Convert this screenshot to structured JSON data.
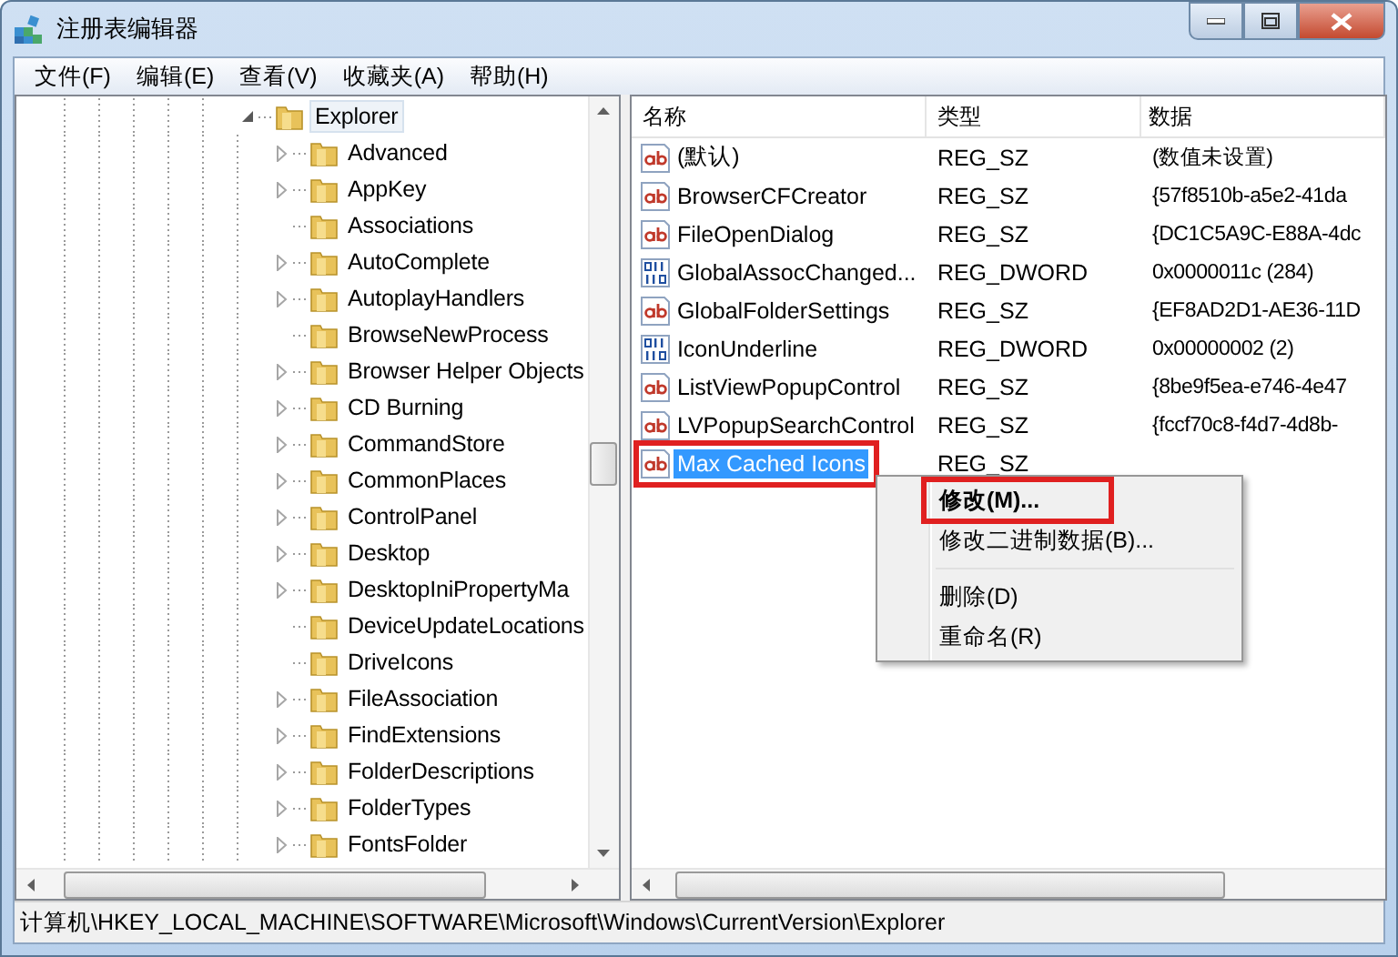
{
  "window": {
    "title": "注册表编辑器"
  },
  "menu": [
    "文件(F)",
    "编辑(E)",
    "查看(V)",
    "收藏夹(A)",
    "帮助(H)"
  ],
  "tree": {
    "label": "Explorer",
    "expanded": true,
    "selected": false,
    "children": [
      {
        "label": "Advanced",
        "kind": "branch"
      },
      {
        "label": "AppKey",
        "kind": "branch"
      },
      {
        "label": "Associations",
        "kind": "leaf"
      },
      {
        "label": "AutoComplete",
        "kind": "branch"
      },
      {
        "label": "AutoplayHandlers",
        "kind": "branch"
      },
      {
        "label": "BrowseNewProcess",
        "kind": "leaf"
      },
      {
        "label": "Browser Helper Objects",
        "kind": "branch"
      },
      {
        "label": "CD Burning",
        "kind": "branch"
      },
      {
        "label": "CommandStore",
        "kind": "branch"
      },
      {
        "label": "CommonPlaces",
        "kind": "branch"
      },
      {
        "label": "ControlPanel",
        "kind": "branch"
      },
      {
        "label": "Desktop",
        "kind": "branch"
      },
      {
        "label": "DesktopIniPropertyMa",
        "kind": "branch"
      },
      {
        "label": "DeviceUpdateLocations",
        "kind": "leaf"
      },
      {
        "label": "DriveIcons",
        "kind": "leaf"
      },
      {
        "label": "FileAssociation",
        "kind": "branch"
      },
      {
        "label": "FindExtensions",
        "kind": "branch"
      },
      {
        "label": "FolderDescriptions",
        "kind": "branch"
      },
      {
        "label": "FolderTypes",
        "kind": "branch"
      },
      {
        "label": "FontsFolder",
        "kind": "branch"
      }
    ]
  },
  "table": {
    "columns": [
      "名称",
      "类型",
      "数据"
    ],
    "rows": [
      {
        "kind": "string",
        "name": "(默认)",
        "type": "REG_SZ",
        "data": "(数值未设置)",
        "selected": false,
        "annotated": false
      },
      {
        "kind": "string",
        "name": "BrowserCFCreator",
        "type": "REG_SZ",
        "data": "{57f8510b-a5e2-41da",
        "selected": false,
        "annotated": false
      },
      {
        "kind": "string",
        "name": "FileOpenDialog",
        "type": "REG_SZ",
        "data": "{DC1C5A9C-E88A-4dc",
        "selected": false,
        "annotated": false
      },
      {
        "kind": "dword",
        "name": "GlobalAssocChanged...",
        "type": "REG_DWORD",
        "data": "0x0000011c (284)",
        "selected": false,
        "annotated": false
      },
      {
        "kind": "string",
        "name": "GlobalFolderSettings",
        "type": "REG_SZ",
        "data": "{EF8AD2D1-AE36-11D",
        "selected": false,
        "annotated": false
      },
      {
        "kind": "dword",
        "name": "IconUnderline",
        "type": "REG_DWORD",
        "data": "0x00000002 (2)",
        "selected": false,
        "annotated": false
      },
      {
        "kind": "string",
        "name": "ListViewPopupControl",
        "type": "REG_SZ",
        "data": "{8be9f5ea-e746-4e47",
        "selected": false,
        "annotated": false
      },
      {
        "kind": "string",
        "name": "LVPopupSearchControl",
        "type": "REG_SZ",
        "data": "{fccf70c8-f4d7-4d8b-",
        "selected": false,
        "annotated": false
      },
      {
        "kind": "string",
        "name": "Max Cached Icons",
        "type": "REG_SZ",
        "selected": true,
        "annotated": true
      }
    ]
  },
  "context_menu": [
    {
      "kind": "item",
      "label": "修改(M)...",
      "default": true,
      "annotated": true
    },
    {
      "kind": "item",
      "label": "修改二进制数据(B)...",
      "default": false,
      "annotated": false
    },
    {
      "kind": "separator"
    },
    {
      "kind": "item",
      "label": "删除(D)",
      "default": false,
      "annotated": false
    },
    {
      "kind": "item",
      "label": "重命名(R)",
      "default": false,
      "annotated": false
    }
  ],
  "status_bar": "计算机\\HKEY_LOCAL_MACHINE\\SOFTWARE\\Microsoft\\Windows\\CurrentVersion\\Explorer"
}
